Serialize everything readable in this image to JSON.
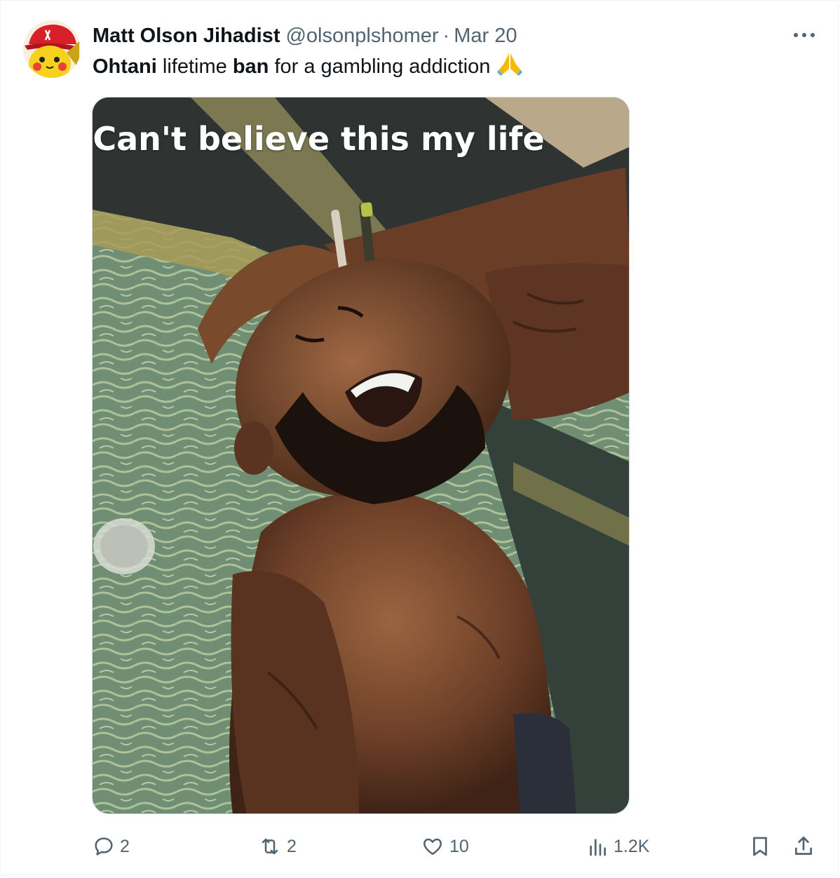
{
  "tweet": {
    "author_name": "Matt Olson Jihadist",
    "handle": "@olsonplshomer",
    "separator": "·",
    "date": "Mar 20",
    "text_parts": [
      "Ohtani",
      " lifetime ",
      "ban",
      " for a gambling addiction"
    ],
    "emoji": "🙏",
    "media_caption": "Can't believe this my life",
    "more_icon": "ellipsis-icon"
  },
  "actions": {
    "replies": "2",
    "reposts": "2",
    "likes": "10",
    "views": "1.2K"
  },
  "colors": {
    "text_primary": "#0f1419",
    "text_secondary": "#536471",
    "border": "#cfd9de"
  }
}
